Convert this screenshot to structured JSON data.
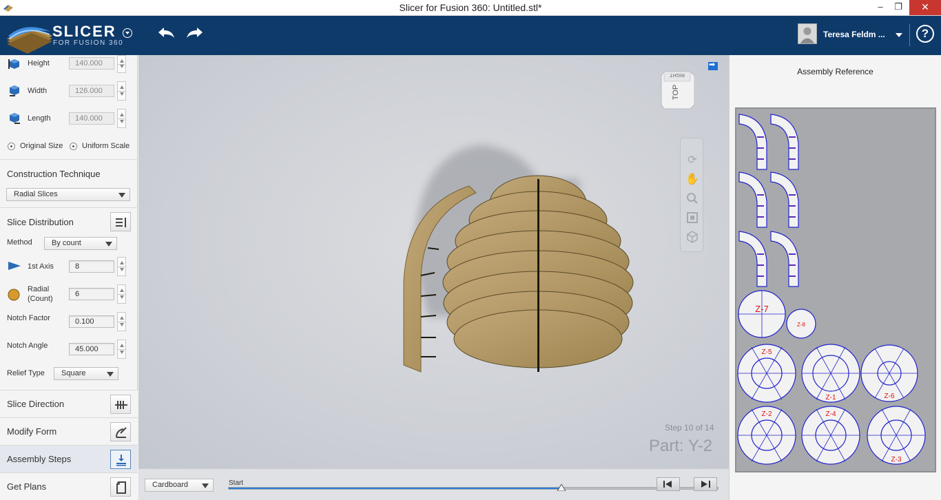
{
  "window": {
    "title": "Slicer for Fusion 360: Untitled.stl*",
    "controls": {
      "minimize": "–",
      "restore": "❐",
      "close": "✕"
    }
  },
  "header": {
    "brand": "SLICER",
    "brand_sub": "FOR FUSION 360",
    "user_name": "Teresa Feldm ...",
    "help": "?"
  },
  "colors": {
    "header_bg": "#0e3a6a",
    "accent_blue": "#2a7bd4",
    "cardboard": "#b39b6a",
    "close_red": "#c7372f"
  },
  "left_panel": {
    "dimensions": [
      {
        "label": "Height",
        "value": "140.000",
        "icon": "box-height-icon"
      },
      {
        "label": "Width",
        "value": "126.000",
        "icon": "box-width-icon"
      },
      {
        "label": "Length",
        "value": "140.000",
        "icon": "box-length-icon"
      }
    ],
    "scale_options": {
      "original": "Original Size",
      "uniform": "Uniform Scale"
    },
    "construction": {
      "title": "Construction Technique",
      "selected": "Radial Slices"
    },
    "distribution": {
      "title": "Slice Distribution",
      "method_label": "Method",
      "method_value": "By count",
      "first_axis_label": "1st Axis",
      "first_axis_value": "8",
      "radial_label_1": "Radial",
      "radial_label_2": "(Count)",
      "radial_value": "6",
      "notch_factor_label": "Notch Factor",
      "notch_factor_value": "0.100",
      "notch_angle_label": "Notch Angle",
      "notch_angle_value": "45.000",
      "relief_label": "Relief Type",
      "relief_value": "Square"
    },
    "nav": [
      {
        "label": "Slice Direction",
        "icon": "slice-direction-icon"
      },
      {
        "label": "Modify Form",
        "icon": "modify-form-icon"
      },
      {
        "label": "Assembly Steps",
        "icon": "assembly-steps-icon"
      },
      {
        "label": "Get Plans",
        "icon": "get-plans-icon"
      }
    ]
  },
  "viewport": {
    "viewcube_top": "TOP",
    "viewcube_right": "RIGHT",
    "step_text": "Step 10 of 14",
    "part_text": "Part: Y-2"
  },
  "bottom_bar": {
    "material": "Cardboard",
    "timeline_label": "Start",
    "progress": 0.68
  },
  "right_panel": {
    "title": "Assembly Reference",
    "rings": [
      "Z-7",
      "Z-8",
      "Z-5",
      "Z-1",
      "Z-6",
      "Z-2",
      "Z-4",
      "Z-3"
    ]
  }
}
